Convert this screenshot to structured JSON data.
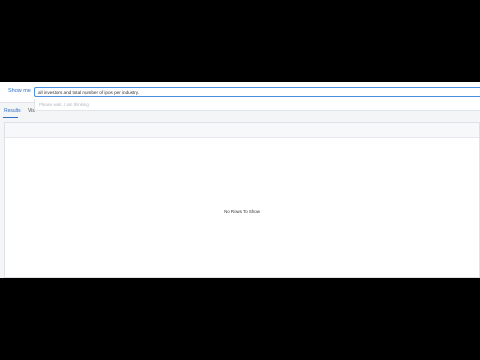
{
  "query_bar": {
    "label": "Show me",
    "input_value": "all investors and total number of ipos per industry.",
    "suggestion": "Please wait, I am thinking"
  },
  "tabs": [
    {
      "label": "Results",
      "active": true
    },
    {
      "label": "Vis",
      "active": false
    }
  ],
  "results": {
    "empty_message": "No Rows To Show"
  },
  "colors": {
    "accent": "#2f6fc7",
    "input_border": "#4a90e2",
    "background": "#f4f5f7",
    "letterbox": "#000000"
  }
}
